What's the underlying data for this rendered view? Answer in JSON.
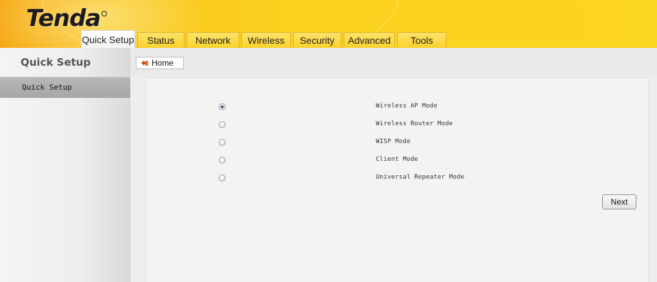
{
  "header": {
    "logo_text": "Tenda"
  },
  "tabs": [
    {
      "label": "Quick Setup",
      "active": true
    },
    {
      "label": "Status"
    },
    {
      "label": "Network"
    },
    {
      "label": "Wireless"
    },
    {
      "label": "Security"
    },
    {
      "label": "Advanced"
    },
    {
      "label": "Tools"
    }
  ],
  "sidebar": {
    "title": "Quick Setup",
    "items": [
      {
        "label": "Quick Setup",
        "selected": true
      }
    ]
  },
  "breadcrumb": {
    "home_label": "Home",
    "icon": "home-arrow-icon"
  },
  "modes": [
    {
      "label": "Wireless AP Mode",
      "checked": true
    },
    {
      "label": "Wireless Router Mode",
      "checked": false
    },
    {
      "label": "WISP Mode",
      "checked": false
    },
    {
      "label": "Client Mode",
      "checked": false
    },
    {
      "label": "Universal Repeater Mode",
      "checked": false
    }
  ],
  "actions": {
    "next_label": "Next"
  },
  "colors": {
    "header_yellow": "#fcd521",
    "header_orange": "#f7a713",
    "sidebar_selected": "#b0b0b0",
    "panel_bg": "#f3f3f3"
  }
}
